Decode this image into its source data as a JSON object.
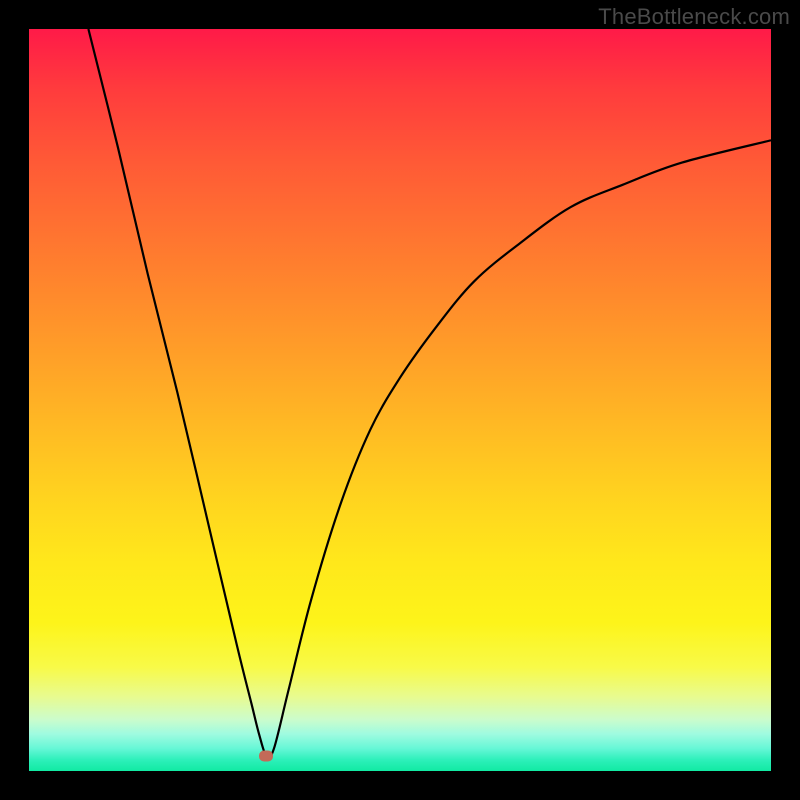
{
  "watermark": "TheBottleneck.com",
  "colors": {
    "curve_stroke": "#000000",
    "dot_fill": "#c36a58"
  },
  "chart_data": {
    "type": "line",
    "title": "",
    "xlabel": "",
    "ylabel": "",
    "xlim": [
      0,
      100
    ],
    "ylim": [
      0,
      100
    ],
    "grid": false,
    "legend": false,
    "annotations": [],
    "marker": {
      "x": 32,
      "y": 2
    },
    "series": [
      {
        "name": "curve",
        "x": [
          8,
          12,
          16,
          20,
          24,
          28,
          30,
          31,
          32,
          33,
          35,
          38,
          42,
          46,
          50,
          55,
          60,
          66,
          73,
          80,
          88,
          100
        ],
        "values": [
          100,
          84,
          67,
          51,
          34,
          17,
          9,
          5,
          2,
          3,
          11,
          23,
          36,
          46,
          53,
          60,
          66,
          71,
          76,
          79,
          82,
          85
        ]
      }
    ]
  }
}
